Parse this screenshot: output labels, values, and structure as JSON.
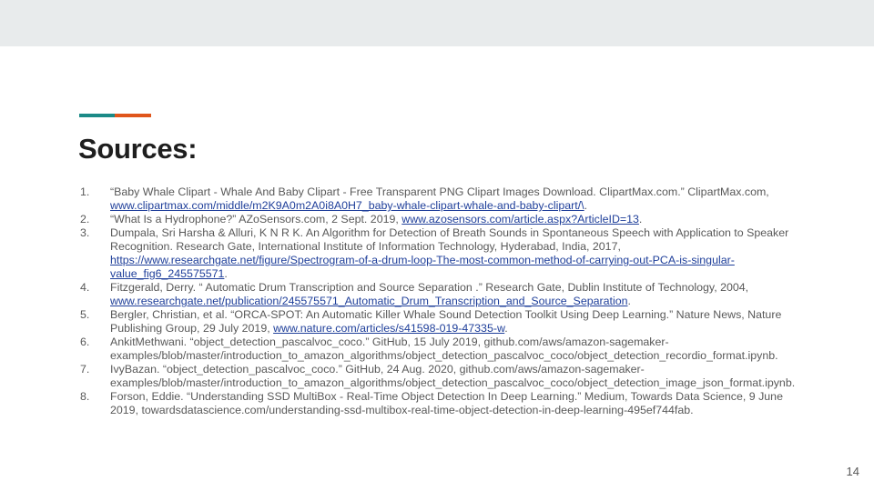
{
  "slide": {
    "title": "Sources:",
    "page_number": "14",
    "colors": {
      "top_bar": "#e8ebec",
      "accent_teal": "#1b8a87",
      "accent_orange": "#e0561c",
      "link": "#1f3f9a",
      "body_text": "#595959"
    }
  },
  "references": [
    {
      "num": "1.",
      "text": "“Baby Whale Clipart - Whale And Baby Clipart - Free Transparent PNG Clipart Images Download. ClipartMax.com.” ClipartMax.com, ",
      "link": "www.clipartmax.com/middle/m2K9A0m2A0i8A0H7_baby-whale-clipart-whale-and-baby-clipart/\\",
      "after": "."
    },
    {
      "num": "2.",
      "text": "“What Is a Hydrophone?” AZoSensors.com, 2 Sept. 2019, ",
      "link": "www.azosensors.com/article.aspx?ArticleID=13",
      "after": "."
    },
    {
      "num": "3.",
      "text": "Dumpala, Sri Harsha & Alluri, K N R K.  An Algorithm for Detection of Breath Sounds in Spontaneous Speech with Application to Speaker Recognition. Research Gate, International Institute of Information Technology, Hyderabad, India, 2017, ",
      "link": "https://www.researchgate.net/figure/Spectrogram-of-a-drum-loop-The-most-common-method-of-carrying-out-PCA-is-singular-value_fig6_245575571",
      "after": "."
    },
    {
      "num": "4.",
      "text": "Fitzgerald, Derry. “ Automatic Drum Transcription and Source Separation .” Research Gate, Dublin Institute of Technology, 2004, ",
      "link": "www.researchgate.net/publication/245575571_Automatic_Drum_Transcription_and_Source_Separation",
      "after": "."
    },
    {
      "num": "5.",
      "text": "Bergler, Christian, et al. “ORCA-SPOT: An Automatic Killer Whale Sound Detection Toolkit Using Deep Learning.” Nature News, Nature Publishing Group, 29 July 2019, ",
      "link": "www.nature.com/articles/s41598-019-47335-w",
      "after": "."
    },
    {
      "num": "6.",
      "text": "AnkitMethwani. “object_detection_pascalvoc_coco.” GitHub, 15 July 2019, github.com/aws/amazon-sagemaker-examples/blob/master/introduction_to_amazon_algorithms/object_detection_pascalvoc_coco/object_detection_recordio_format.ipynb.",
      "link": "",
      "after": ""
    },
    {
      "num": "7.",
      "text": "IvyBazan. “object_detection_pascalvoc_coco.” GitHub, 24 Aug. 2020, github.com/aws/amazon-sagemaker-examples/blob/master/introduction_to_amazon_algorithms/object_detection_pascalvoc_coco/object_detection_image_json_format.ipynb.",
      "link": "",
      "after": ""
    },
    {
      "num": "8.",
      "text": "Forson, Eddie. “Understanding SSD MultiBox - Real-Time Object Detection In Deep Learning.” Medium, Towards Data Science, 9 June 2019, towardsdatascience.com/understanding-ssd-multibox-real-time-object-detection-in-deep-learning-495ef744fab.",
      "link": "",
      "after": ""
    }
  ]
}
